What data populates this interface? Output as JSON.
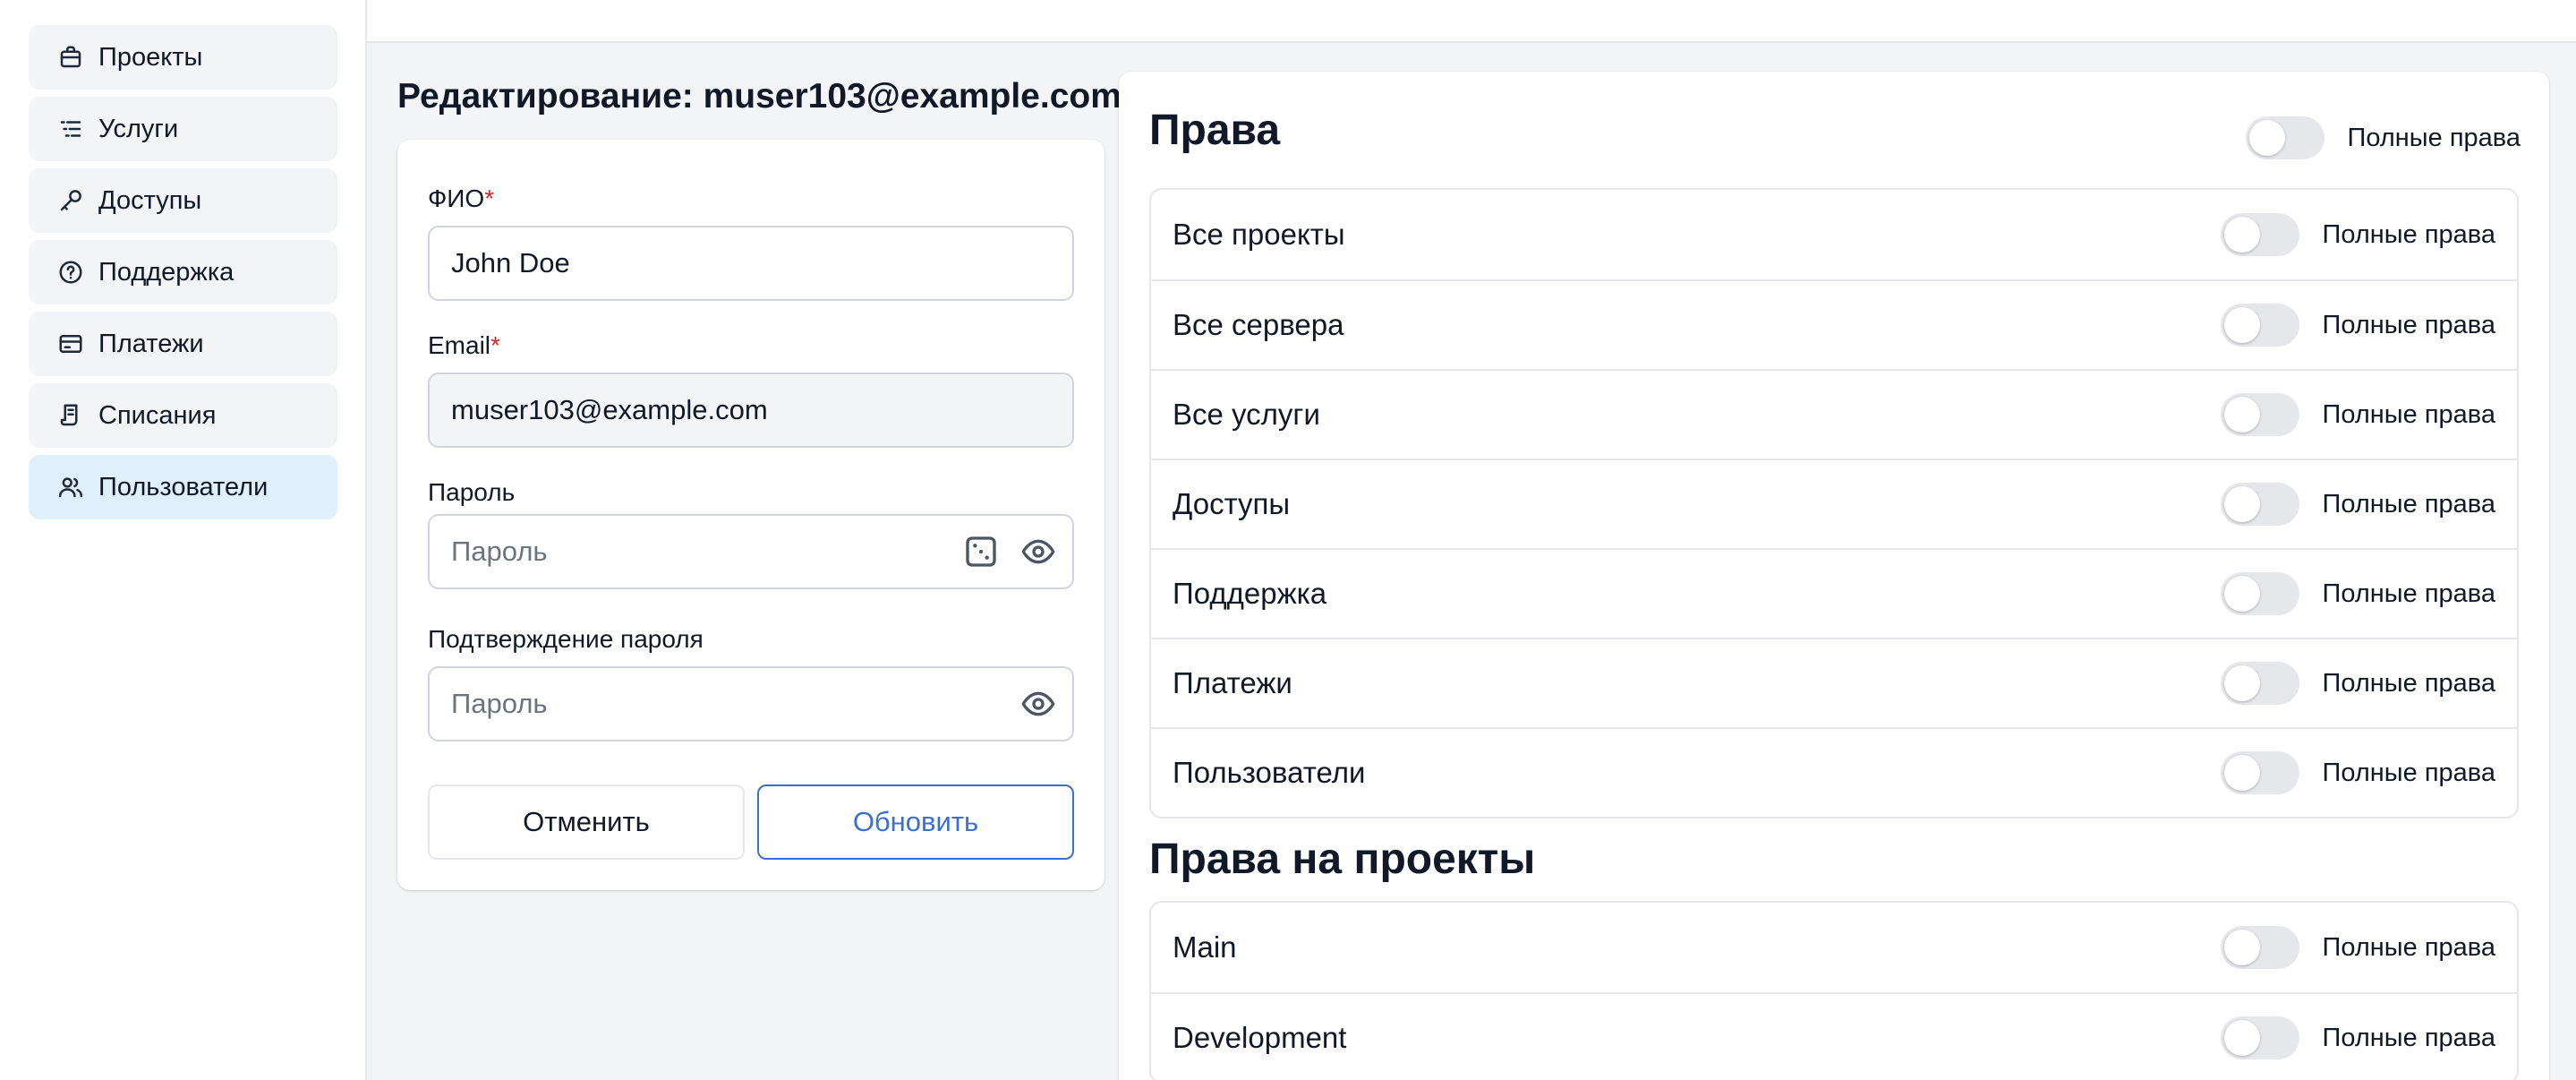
{
  "sidebar": {
    "items": [
      {
        "label": "Проекты",
        "icon": "briefcase-icon"
      },
      {
        "label": "Услуги",
        "icon": "list-icon"
      },
      {
        "label": "Доступы",
        "icon": "key-icon"
      },
      {
        "label": "Поддержка",
        "icon": "help-circle-icon"
      },
      {
        "label": "Платежи",
        "icon": "credit-card-icon"
      },
      {
        "label": "Списания",
        "icon": "receipt-icon"
      },
      {
        "label": "Пользователи",
        "icon": "users-icon",
        "active": true
      }
    ]
  },
  "page": {
    "title": "Редактирование: muser103@example.com"
  },
  "form": {
    "fio_label": "ФИО",
    "fio_required": "*",
    "fio_value": "John Doe",
    "email_label": "Email",
    "email_required": "*",
    "email_value": "muser103@example.com",
    "password_label": "Пароль",
    "password_placeholder": "Пароль",
    "confirm_label": "Подтверждение пароля",
    "confirm_placeholder": "Пароль",
    "cancel_label": "Отменить",
    "update_label": "Обновить"
  },
  "rights": {
    "title": "Права",
    "full_rights_label": "Полные права",
    "items": [
      {
        "label": "Все проекты",
        "toggle_label": "Полные права",
        "enabled": false
      },
      {
        "label": "Все сервера",
        "toggle_label": "Полные права",
        "enabled": false
      },
      {
        "label": "Все услуги",
        "toggle_label": "Полные права",
        "enabled": false
      },
      {
        "label": "Доступы",
        "toggle_label": "Полные права",
        "enabled": false
      },
      {
        "label": "Поддержка",
        "toggle_label": "Полные права",
        "enabled": false
      },
      {
        "label": "Платежи",
        "toggle_label": "Полные права",
        "enabled": false
      },
      {
        "label": "Пользователи",
        "toggle_label": "Полные права",
        "enabled": false
      }
    ]
  },
  "project_rights": {
    "title": "Права на проекты",
    "items": [
      {
        "label": "Main",
        "toggle_label": "Полные права",
        "enabled": false
      },
      {
        "label": "Development",
        "toggle_label": "Полные права",
        "enabled": false
      }
    ]
  },
  "colors": {
    "accent": "#3b6fd8",
    "required": "#dc2626",
    "active_nav": "#e0effc"
  }
}
